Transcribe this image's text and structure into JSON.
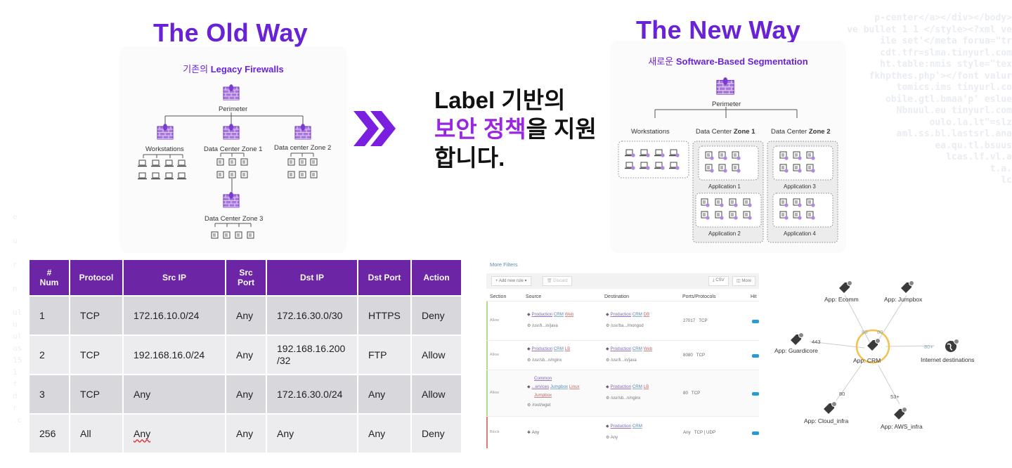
{
  "background_code": {
    "right_lines": [
      "p-center</a></div></body>",
      "ve bullet 1 1 </style><?xml ve",
      "ile set'</meta forua=\"tr",
      "cdt.tfr=slma.tinyurl.com",
      "ht.table:nmis style=\"tex",
      "fkhpthes.php'></font valur",
      "tomics.ims tinyurl.co",
      "obile.gtl.bmaa'p' eslue",
      "Nbnuul.eu tinyurl.com",
      "oulo.la.lt\"=slz",
      "aml.ss.bl.lastsrl.ana",
      "ea.qu.tl.bsuus",
      "lcas.lf.vl.a",
      "t.a.",
      "lc"
    ],
    "left_lines": [
      "e",
      "",
      "u",
      "",
      "r",
      "",
      "n",
      "",
      "ul",
      "u",
      "ul",
      "as",
      "15",
      "1",
      "f",
      "d",
      "r",
      ".c"
    ]
  },
  "old_way": {
    "title": "The Old Way",
    "subtitle_ko": "기존의",
    "subtitle_en": "Legacy Firewalls",
    "perimeter": "Perimeter",
    "zones": [
      "Workstations",
      "Data Center Zone 1",
      "Data center Zone 2",
      "Data Center Zone 3"
    ]
  },
  "new_way": {
    "title": "The New Way",
    "subtitle_ko": "새로운",
    "subtitle_en": "Software-Based Segmentation",
    "perimeter": "Perimeter",
    "workstations": "Workstations",
    "zone1_prefix": "Data Center ",
    "zone1_bold": "Zone 1",
    "zone2_prefix": "Data Center ",
    "zone2_bold": "Zone 2",
    "applications": [
      "Application 1",
      "Application 2",
      "Application 3",
      "Application 4"
    ]
  },
  "center": {
    "line1": "Label 기반의",
    "line2_highlight": "보안 정책",
    "line2_rest": "을 지원",
    "line3": "합니다.",
    "highlight_color": "#9a27e0",
    "arrow_color": "#7a1fe0"
  },
  "firewall_table": {
    "headers": [
      "#\nNum",
      "Protocol",
      "Src IP",
      "Src\nPort",
      "Dst IP",
      "Dst Port",
      "Action"
    ],
    "header_num_icon": "#",
    "header_num_label": "Num",
    "header_srcport_1": "Src",
    "header_srcport_2": "Port",
    "rows": [
      [
        "1",
        "TCP",
        "172.16.10.0/24",
        "Any",
        "172.16.30.0/30",
        "HTTPS",
        "Deny"
      ],
      [
        "2",
        "TCP",
        "192.168.16.0/24",
        "Any",
        "192.168.16.200\n/32",
        "FTP",
        "Allow"
      ],
      [
        "3",
        "TCP",
        "Any",
        "Any",
        "172.16.30.0/24",
        "Any",
        "Allow"
      ],
      [
        "256",
        "All",
        "Any",
        "Any",
        "Any",
        "Any",
        "Deny"
      ]
    ],
    "header_color": "#6c25a4"
  },
  "policy_panel": {
    "more_filters": "More Filters",
    "add_rule": "+ Add new rule",
    "discard": "Discard",
    "csv": "CSV",
    "more": "More",
    "columns": [
      "Section",
      "Source",
      "Destination",
      "Ports/Protocols",
      "Hit"
    ],
    "rows": [
      {
        "section": "Allow",
        "src_tags": [
          "Production",
          "CRM",
          "Web"
        ],
        "src_proc": "/usr/li...in/java",
        "dst_tags": [
          "Production",
          "CRM",
          "DB"
        ],
        "dst_proc": "/usr/ba.../mongod",
        "ports": "27017   TCP"
      },
      {
        "section": "Allow",
        "src_tags": [
          "Production",
          "CRM",
          "LB"
        ],
        "src_proc": "/usr/sb...n/nginx",
        "dst_tags": [
          "Production",
          "CRM",
          "Web"
        ],
        "dst_proc": "/usr/li...in/java",
        "ports": "8080   TCP"
      },
      {
        "section": "Allow",
        "src_tags_line1": "Common",
        "src_tags": [
          "...ervices",
          "Jumpbox",
          "Linux"
        ],
        "src_tags_line3": "Jumpbox",
        "src_proc": "/root/wget",
        "dst_tags": [
          "Production",
          "CRM",
          "LB"
        ],
        "dst_proc": "/usr/sb...n/nginx",
        "ports": "80   TCP"
      },
      {
        "section": "Block",
        "src_any": "Any",
        "dst_tags": [
          "Production",
          "CRM"
        ],
        "dst_proc": "Any",
        "ports": "Any   TCP | UDP"
      }
    ]
  },
  "graph": {
    "center": "App: CRM",
    "nodes": {
      "ecomm": "App: Ecomm",
      "jumpbox": "App: Jumpbox",
      "guardicore": "App: Guardicore",
      "internet": "Internet destinations",
      "cloud": "App: Cloud_infra",
      "aws": "App: AWS_infra"
    },
    "ports": {
      "ecomm": "80",
      "jumpbox": "80",
      "guardicore": "443",
      "internet": "80+",
      "cloud": "80",
      "aws": "53+"
    }
  }
}
